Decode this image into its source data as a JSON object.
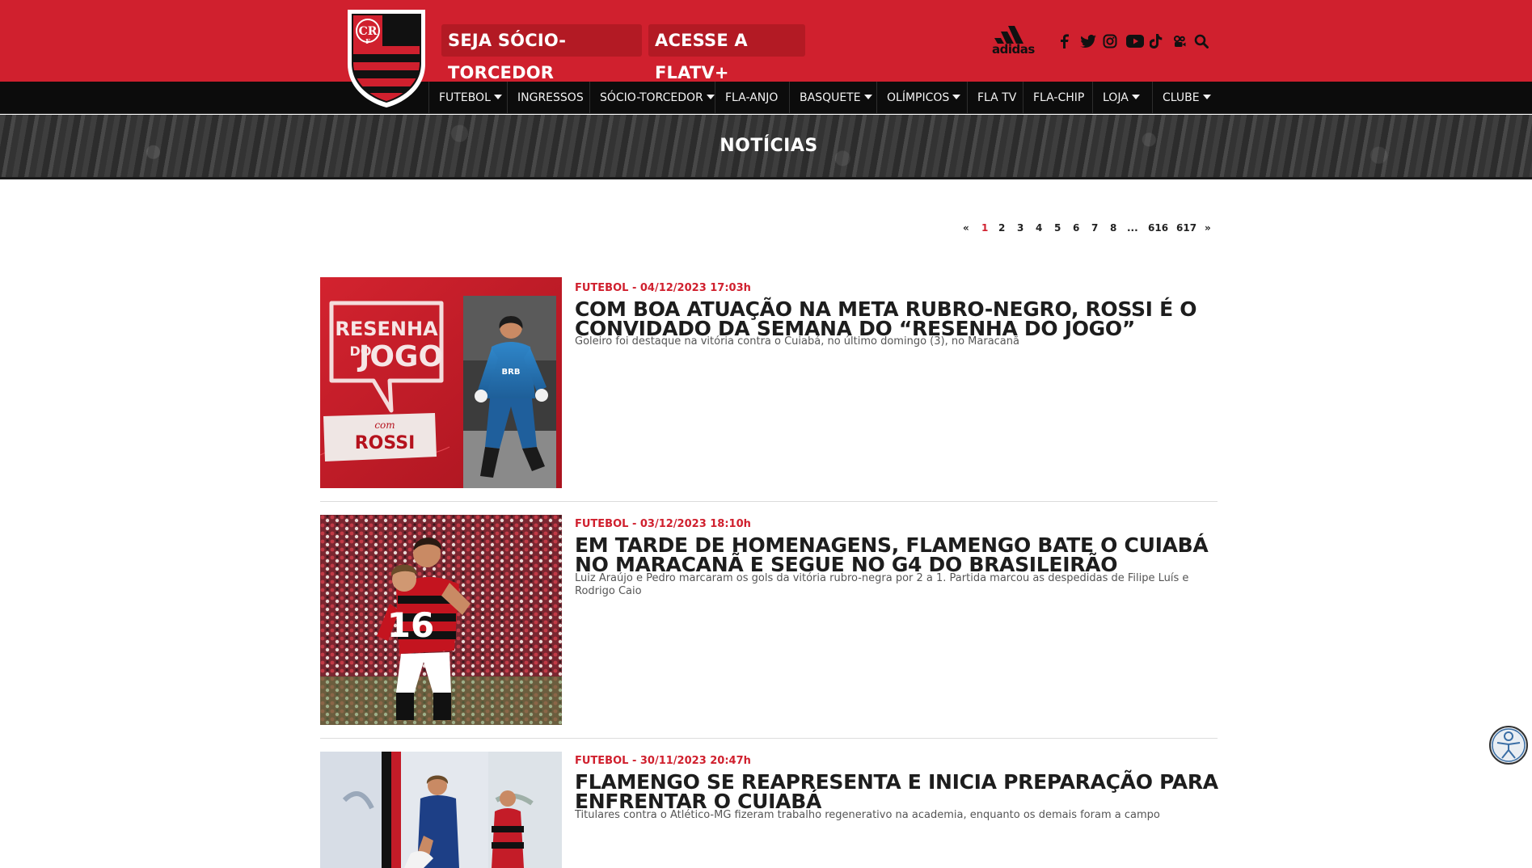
{
  "header": {
    "cta_socio": "SEJA SÓCIO-TORCEDOR",
    "cta_flatv": "ACESSE A FLATV+",
    "sponsor": "adidas",
    "brand_red": "#d0202e",
    "social_icons": [
      "facebook-icon",
      "twitter-icon",
      "instagram-icon",
      "youtube-icon",
      "tiktok-icon",
      "kwai-icon",
      "search-icon"
    ]
  },
  "nav": {
    "items": [
      {
        "label": "FUTEBOL",
        "dropdown": true
      },
      {
        "label": "INGRESSOS",
        "dropdown": false
      },
      {
        "label": "SÓCIO-TORCEDOR",
        "dropdown": true
      },
      {
        "label": "FLA-ANJO",
        "dropdown": false
      },
      {
        "label": "BASQUETE",
        "dropdown": true
      },
      {
        "label": "OLÍMPICOS",
        "dropdown": true
      },
      {
        "label": "FLA TV",
        "dropdown": false
      },
      {
        "label": "FLA-CHIP",
        "dropdown": false
      },
      {
        "label": "LOJA",
        "dropdown": true
      },
      {
        "label": "CLUBE",
        "dropdown": true
      }
    ]
  },
  "banner": {
    "title": "NOTÍCIAS"
  },
  "pagination": {
    "prev": "«",
    "pages": [
      "1",
      "2",
      "3",
      "4",
      "5",
      "6",
      "7",
      "8"
    ],
    "ellipsis": "...",
    "last_pages": [
      "616",
      "617"
    ],
    "next": "»",
    "current": "1"
  },
  "articles": [
    {
      "meta": "FUTEBOL - 04/12/2023 17:03h",
      "title": "COM BOA ATUAÇÃO NA META RUBRO-NEGRO, ROSSI É O CONVIDADO DA SEMANA DO “RESENHA DO JOGO”",
      "summary": "Goleiro foi destaque na vitória contra o Cuiabá, no último domingo (3), no Maracanã",
      "thumb_text": {
        "line1": "RESENHA",
        "line2": "DO",
        "line3": "JOGO",
        "with": "com",
        "name": "ROSSI"
      }
    },
    {
      "meta": "FUTEBOL - 03/12/2023 18:10h",
      "title": "EM TARDE DE HOMENAGENS, FLAMENGO BATE O CUIABÁ NO MARACANÃ E SEGUE NO G4 DO BRASILEIRÃO",
      "summary": "Luiz Araújo e Pedro marcaram os gols da vitória rubro-negra por 2 a 1. Partida marcou as despedidas de Filipe Luís e Rodrigo Caio",
      "thumb_text": {
        "number": "16"
      }
    },
    {
      "meta": "FUTEBOL - 30/11/2023 20:47h",
      "title": "FLAMENGO SE REAPRESENTA E INICIA PREPARAÇÃO PARA ENFRENTAR O CUIABÁ",
      "summary": "Titulares contra o Atlético-MG fizeram trabalho regenerativo na academia, enquanto os demais foram a campo"
    }
  ]
}
